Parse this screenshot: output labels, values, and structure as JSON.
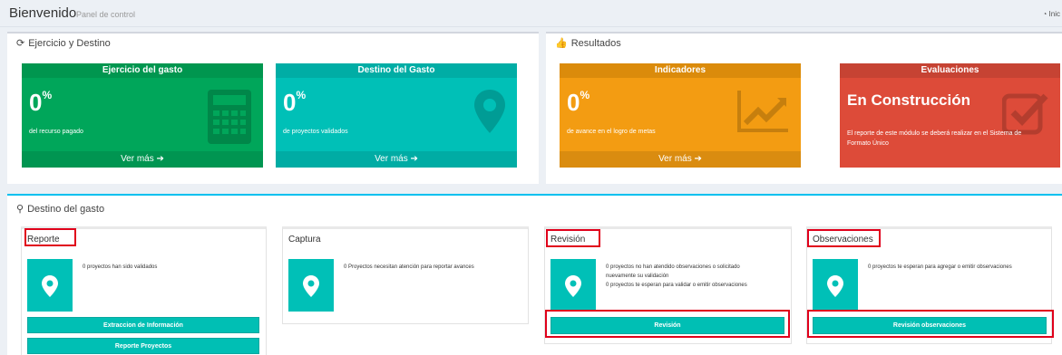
{
  "header": {
    "title": "Bienvenido",
    "subtitle": "Panel de control",
    "breadcrumb": "Inic"
  },
  "section1": {
    "title": "Ejercicio y Destino",
    "tiles": [
      {
        "heading": "Ejercicio del gasto",
        "value": "0",
        "unit": "%",
        "text": "del recurso pagado",
        "more": "Ver más",
        "color": "#00a65a"
      },
      {
        "heading": "Destino del Gasto",
        "value": "0",
        "unit": "%",
        "text": "de proyectos validados",
        "more": "Ver más",
        "color": "#00c0b7"
      }
    ]
  },
  "section2": {
    "title": "Resultados",
    "tiles": [
      {
        "heading": "Indicadores",
        "value": "0",
        "unit": "%",
        "text": "de avance en el logro de metas",
        "more": "Ver más",
        "color": "#f39c12"
      },
      {
        "heading": "Evaluaciones",
        "value": "En Construcción",
        "text_line1": "El reporte de este módulo se deberá realizar en el Sistema de",
        "text_line2": "Formato Único",
        "color": "#dd4b39"
      }
    ]
  },
  "section3": {
    "title": "Destino del gasto",
    "panels": [
      {
        "title": "Reporte",
        "text": "0 proyectos han sido validados",
        "buttons": [
          "Extraccion de Información",
          "Reporte Proyectos"
        ]
      },
      {
        "title": "Captura",
        "text": "0 Proyectos necesitan atención para reportar avances"
      },
      {
        "title": "Revisión",
        "text_line1": "0 proyectos no han atendido observaciones o solicitado",
        "text_line2": "nuevamente su validación",
        "text_line3": "0 proyectos te esperan para validar o emitir observaciones",
        "buttons": [
          "Revisión"
        ]
      },
      {
        "title": "Observaciones",
        "text": "0 proyectos te esperan para agregar o emitir observaciones",
        "buttons": [
          "Revisión observaciones"
        ]
      }
    ]
  }
}
